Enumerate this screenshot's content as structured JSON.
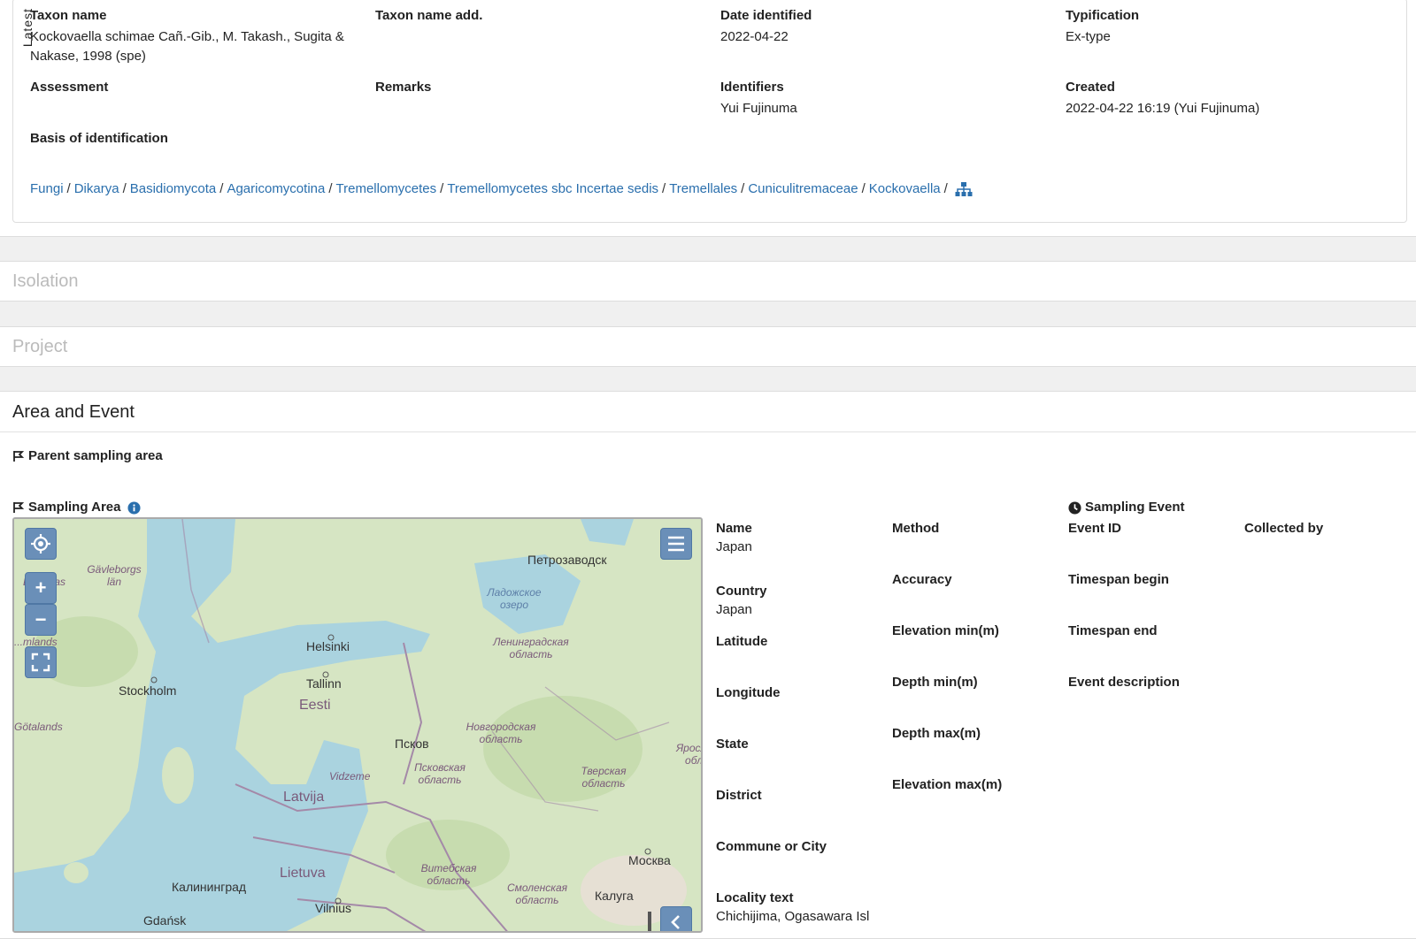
{
  "identification": {
    "tab_label": "Latest",
    "fields": {
      "taxon_name": {
        "label": "Taxon name",
        "value": "Kockovaella schimae Cañ.-Gib., M. Takash., Sugita & Nakase, 1998 (spe)"
      },
      "taxon_name_add": {
        "label": "Taxon name add.",
        "value": ""
      },
      "date_identified": {
        "label": "Date identified",
        "value": "2022-04-22"
      },
      "typification": {
        "label": "Typification",
        "value": "Ex-type"
      },
      "assessment": {
        "label": "Assessment",
        "value": ""
      },
      "remarks": {
        "label": "Remarks",
        "value": ""
      },
      "identifiers": {
        "label": "Identifiers",
        "value": "Yui Fujinuma"
      },
      "created": {
        "label": "Created",
        "value": "2022-04-22 16:19 (Yui Fujinuma)"
      },
      "basis": {
        "label": "Basis of identification",
        "value": ""
      }
    },
    "lineage": [
      "Fungi",
      "Dikarya",
      "Basidiomycota",
      "Agaricomycotina",
      "Tremellomycetes",
      "Tremellomycetes sbc Incertae sedis",
      "Tremellales",
      "Cuniculitremaceae",
      "Kockovaella"
    ],
    "lineage_separator": "/",
    "tree_icon": "sitemap-icon"
  },
  "panels": {
    "isolation": "Isolation",
    "project": "Project",
    "area_event": "Area and Event"
  },
  "area": {
    "parent_label": "Parent sampling area",
    "sampling_area_label": "Sampling Area",
    "fields": [
      {
        "label": "Name",
        "value": "Japan"
      },
      {
        "label": "Country",
        "value": "Japan"
      },
      {
        "label": "Latitude",
        "value": ""
      },
      {
        "label": "Longitude",
        "value": ""
      },
      {
        "label": "State",
        "value": ""
      },
      {
        "label": "District",
        "value": ""
      },
      {
        "label": "Commune or City",
        "value": ""
      },
      {
        "label": "Locality text",
        "value": "Chichijima, Ogasawara Isl"
      }
    ],
    "method_fields": [
      {
        "label": "Method",
        "value": ""
      },
      {
        "label": "Accuracy",
        "value": ""
      },
      {
        "label": "Elevation min(m)",
        "value": ""
      },
      {
        "label": "Depth min(m)",
        "value": ""
      },
      {
        "label": "Depth max(m)",
        "value": ""
      },
      {
        "label": "Elevation max(m)",
        "value": ""
      }
    ]
  },
  "event": {
    "title": "Sampling Event",
    "fields": [
      {
        "label": "Event ID",
        "value": ""
      },
      {
        "label": "Timespan begin",
        "value": ""
      },
      {
        "label": "Timespan end",
        "value": ""
      },
      {
        "label": "Event description",
        "value": ""
      }
    ],
    "collected_by": {
      "label": "Collected by",
      "value": ""
    }
  },
  "map": {
    "controls": {
      "zoom_in": "+",
      "zoom_out": "−"
    },
    "labels": {
      "cities": [
        "Петрозаводск",
        "Helsinki",
        "Tallinn",
        "Stockholm",
        "Псков",
        "Москва",
        "Калуга",
        "Калининград",
        "Vilnius",
        "Gdańsk"
      ],
      "regions": [
        "Gävleborgs län",
        "Dalarnas",
        "Ленинградская область",
        "Новгородская область",
        "Псковская область",
        "Тверская область",
        "Ярославская обл",
        "Витебская область",
        "Смоленская область",
        "Vidzeme",
        "Götalands",
        "...mlands"
      ],
      "countries": [
        "Eesti",
        "Latvija",
        "Lietuva"
      ],
      "water": [
        "Ладожское озеро"
      ]
    }
  },
  "colors": {
    "link": "#2a6fad",
    "map_button": "#6a8fb8",
    "water": "#aad3df",
    "land": "#d8e6c8"
  }
}
